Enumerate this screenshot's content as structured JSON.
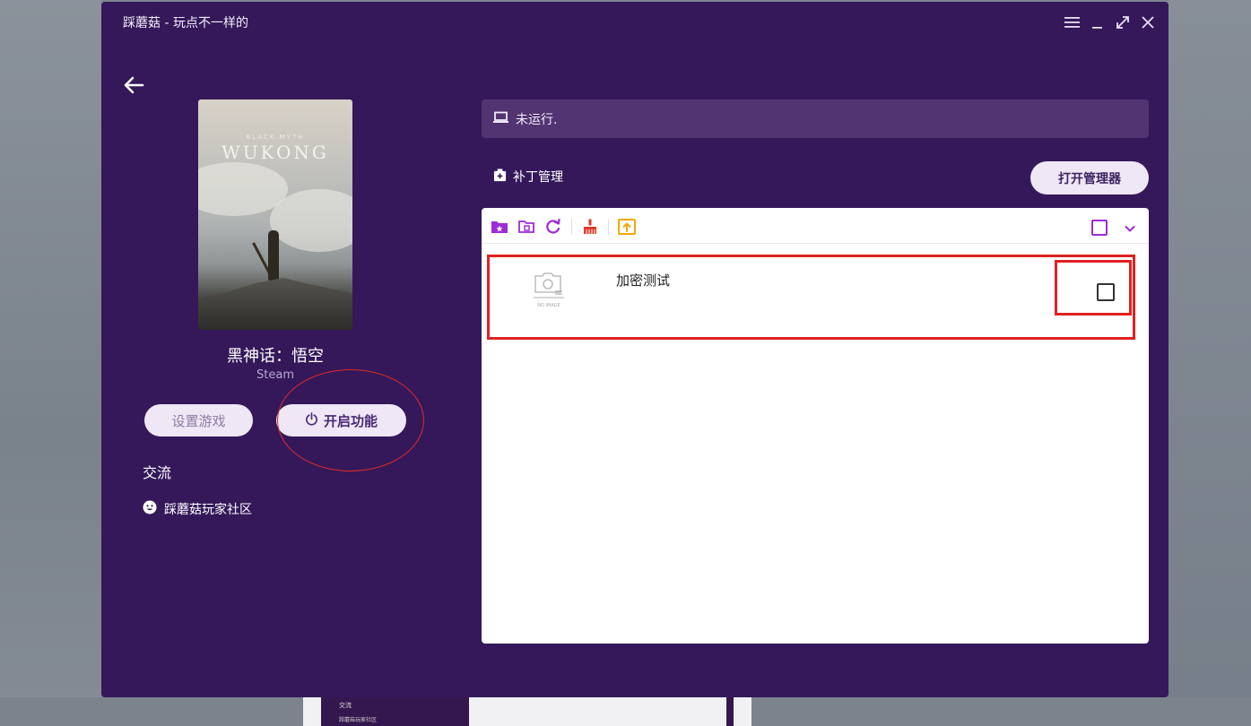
{
  "window": {
    "title": "踩蘑菇 - 玩点不一样的"
  },
  "titlebar_controls": {
    "menu_icon": "menu-icon",
    "minimize_icon": "minimize-icon",
    "maximize_icon": "maximize-icon",
    "close_icon": "close-icon"
  },
  "game": {
    "cover_brand_line1": "BLACK MYTH",
    "cover_brand_line2": "WUKONG",
    "name": "黑神话：悟空",
    "platform": "Steam"
  },
  "actions": {
    "setup_label": "设置游戏",
    "enable_label": "开启功能"
  },
  "exchange": {
    "heading": "交流",
    "community_label": "踩蘑菇玩家社区"
  },
  "status": {
    "text": "未运行."
  },
  "patch": {
    "section_label": "补丁管理",
    "open_manager_label": "打开管理器",
    "items": [
      {
        "name": "加密测试",
        "no_image_label": "NO IMAGE",
        "checked": false
      }
    ]
  },
  "background": {
    "mini_label_1": "交流",
    "mini_label_2": "踩蘑菇玩家社区"
  },
  "colors": {
    "window_bg": "#34185a",
    "status_bg": "#513471",
    "accent_purple": "#9d2bd7",
    "annotation_red": "#e0211f"
  }
}
